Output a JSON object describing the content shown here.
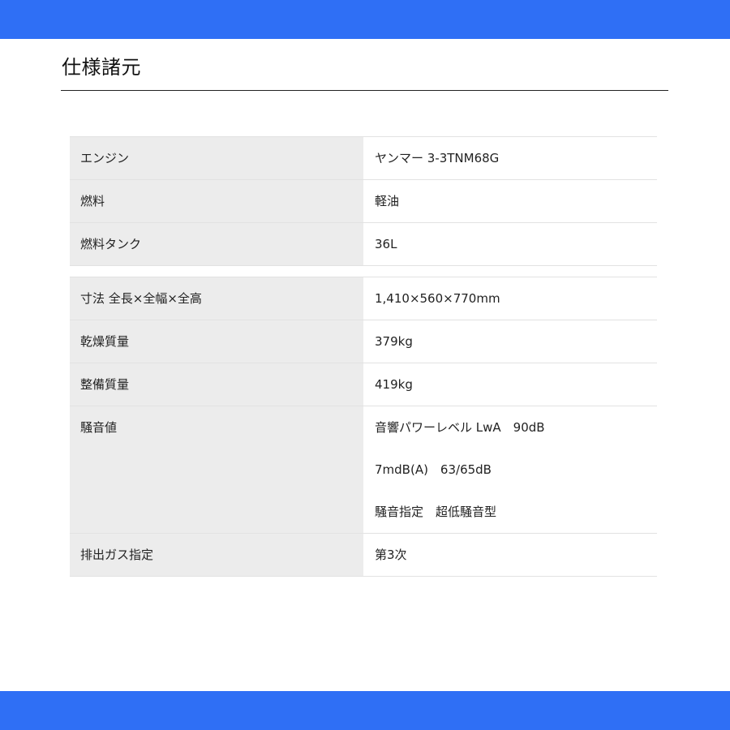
{
  "header": {
    "title": "仕様諸元"
  },
  "table1": {
    "rows": [
      {
        "label": "エンジン",
        "value": "ヤンマー 3-3TNM68G"
      },
      {
        "label": "燃料",
        "value": "軽油"
      },
      {
        "label": "燃料タンク",
        "value": "36L"
      }
    ]
  },
  "table2": {
    "rows": [
      {
        "label": "寸法 全長×全幅×全高",
        "value": "1,410×560×770mm"
      },
      {
        "label": "乾燥質量",
        "value": "379kg"
      },
      {
        "label": "整備質量",
        "value": "419kg"
      },
      {
        "label": "騒音値",
        "values": [
          "音響パワーレベル LwA　90dB",
          "7mdB(A)　63/65dB",
          "騒音指定　超低騒音型"
        ]
      },
      {
        "label": "排出ガス指定",
        "value": "第3次"
      }
    ]
  },
  "colors": {
    "accent_bar": "#2f6ff5",
    "label_background": "#ececec",
    "border": "#e2e2e2"
  }
}
